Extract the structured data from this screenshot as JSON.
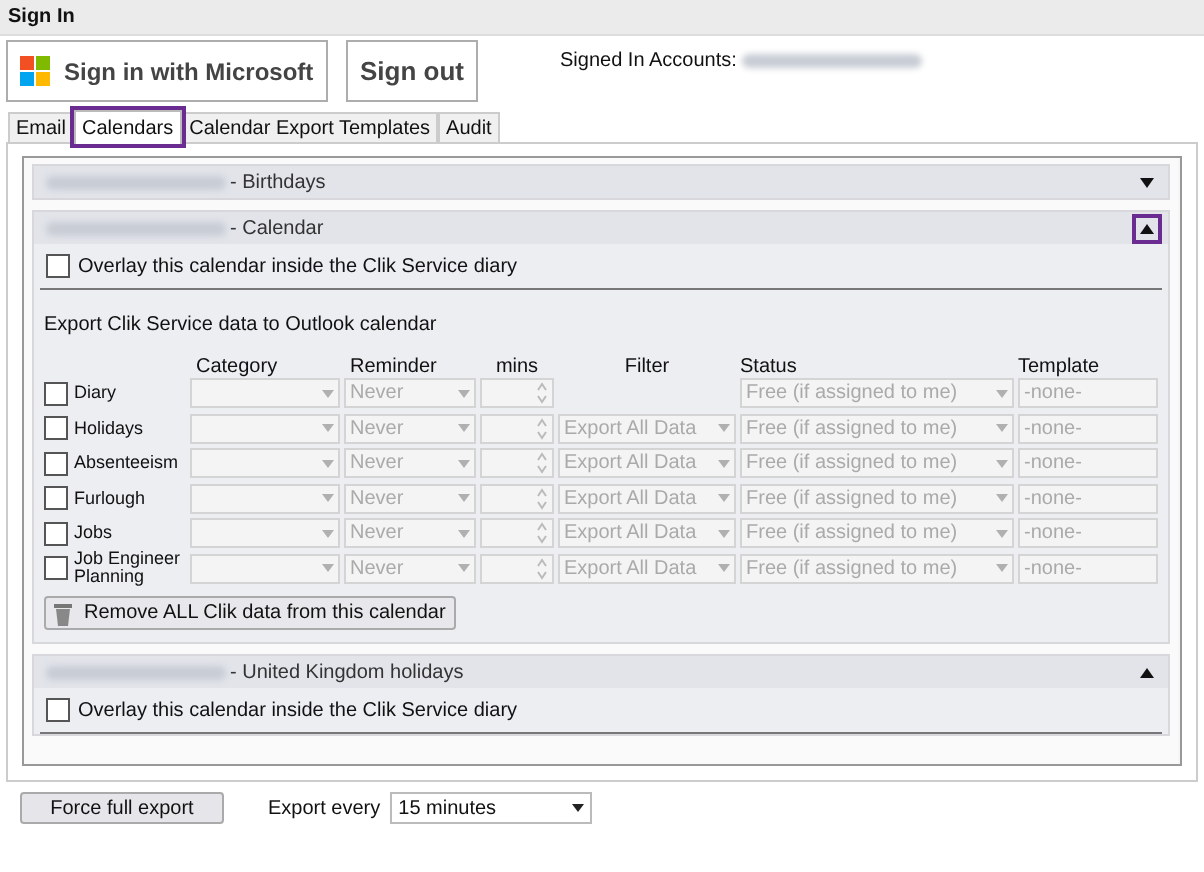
{
  "header": {
    "title": "Sign In"
  },
  "sign_in_button": {
    "label": "Sign in with Microsoft"
  },
  "sign_out_button": {
    "label": "Sign out"
  },
  "signed_in_label": "Signed In Accounts:",
  "tabs": [
    {
      "label": "Email",
      "selected": false,
      "highlighted": false
    },
    {
      "label": "Calendars",
      "selected": true,
      "highlighted": true
    },
    {
      "label": "Calendar Export Templates",
      "selected": false,
      "highlighted": false
    },
    {
      "label": "Audit",
      "selected": false,
      "highlighted": false
    }
  ],
  "sections": [
    {
      "title": "- Birthdays",
      "expanded": false,
      "toggle_highlighted": false
    },
    {
      "title": "- Calendar",
      "expanded": true,
      "toggle_highlighted": true,
      "overlay": {
        "label": "Overlay this calendar inside the Clik Service diary",
        "checked": false
      },
      "export": {
        "heading": "Export Clik Service data to Outlook calendar",
        "columns": [
          "Category",
          "Reminder",
          "mins",
          "Filter",
          "Status",
          "Template"
        ],
        "rows": [
          {
            "label": "Diary",
            "checked": false,
            "reminder": "Never",
            "status": "Free (if assigned to me)",
            "template": "-none-"
          },
          {
            "label": "Holidays",
            "checked": false,
            "reminder": "Never",
            "filter": "Export All Data",
            "status": "Free (if assigned to me)",
            "template": "-none-"
          },
          {
            "label": "Absenteeism",
            "checked": false,
            "reminder": "Never",
            "filter": "Export All Data",
            "status": "Free (if assigned to me)",
            "template": "-none-"
          },
          {
            "label": "Furlough",
            "checked": false,
            "reminder": "Never",
            "filter": "Export All Data",
            "status": "Free (if assigned to me)",
            "template": "-none-"
          },
          {
            "label": "Jobs",
            "checked": false,
            "reminder": "Never",
            "filter": "Export All Data",
            "status": "Free (if assigned to me)",
            "template": "-none-"
          },
          {
            "label": "Job Engineer Planning",
            "checked": false,
            "reminder": "Never",
            "filter": "Export All Data",
            "status": "Free (if assigned to me)",
            "template": "-none-"
          }
        ],
        "remove_button": "Remove ALL Clik data from this calendar"
      }
    },
    {
      "title": "- United Kingdom holidays",
      "expanded": true,
      "toggle_highlighted": false,
      "overlay": {
        "label": "Overlay this calendar inside the Clik Service diary",
        "checked": false
      }
    }
  ],
  "force_export_button": "Force full export",
  "export_every": {
    "label": "Export every",
    "value": "15 minutes"
  }
}
